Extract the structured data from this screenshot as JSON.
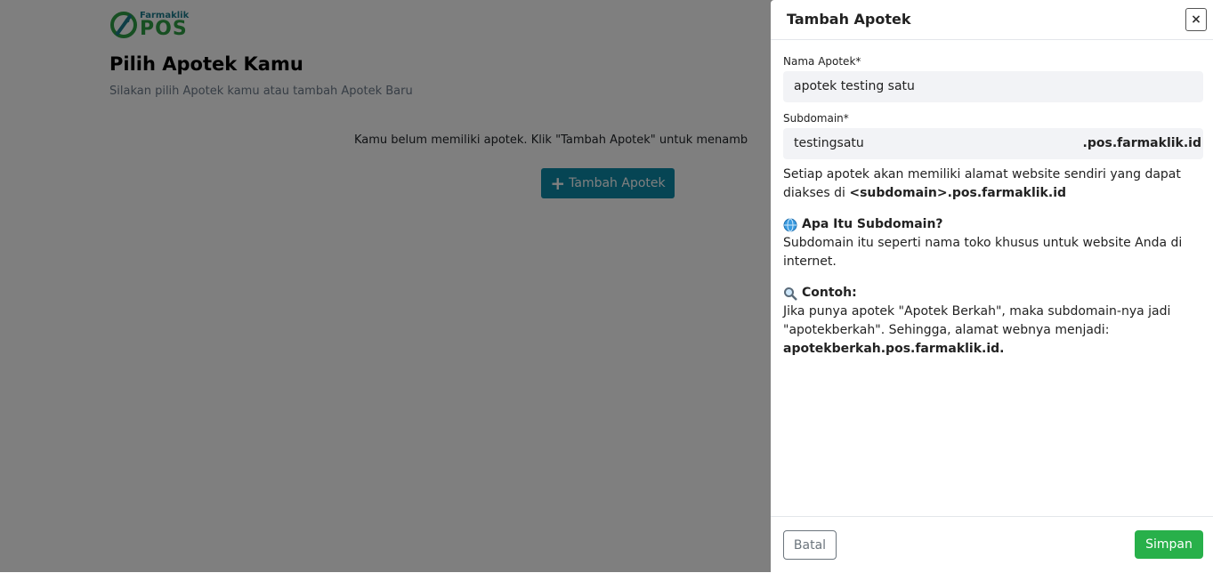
{
  "brand": {
    "small": "Farmaklik",
    "big": "POS"
  },
  "page": {
    "title": "Pilih Apotek Kamu",
    "subtitle": "Silakan pilih Apotek kamu atau tambah Apotek Baru",
    "empty_message": "Kamu belum memiliki apotek. Klik \"Tambah Apotek\" untuk menamb",
    "add_button_label": "Tambah Apotek",
    "add_button_icon": "plus-icon"
  },
  "modal": {
    "title": "Tambah Apotek",
    "close_icon": "close-icon",
    "name_label": "Nama Apotek*",
    "name_value": "apotek testing satu",
    "subdomain_label": "Subdomain*",
    "subdomain_value": "testingsatu",
    "subdomain_suffix": ".pos.farmaklik.id",
    "help_part1": "Setiap apotek akan memiliki alamat website sendiri yang dapat diakses di ",
    "help_bold": "<subdomain>.pos.farmaklik.id",
    "what_heading": "Apa Itu Subdomain?",
    "what_icon": "globe-icon",
    "what_text": "Subdomain itu seperti nama toko khusus untuk website Anda di internet.",
    "example_heading": "Contoh:",
    "example_icon": "magnifier-icon",
    "example_text": "Jika punya apotek \"Apotek Berkah\", maka subdomain-nya jadi \"apotekberkah\". Sehingga, alamat webnya menjadi:",
    "example_bold": "apotekberkah.pos.farmaklik.id.",
    "cancel_label": "Batal",
    "save_label": "Simpan"
  },
  "colors": {
    "primary": "#0d8aa8",
    "success": "#28b04a",
    "brand_green": "#2e9e45"
  }
}
